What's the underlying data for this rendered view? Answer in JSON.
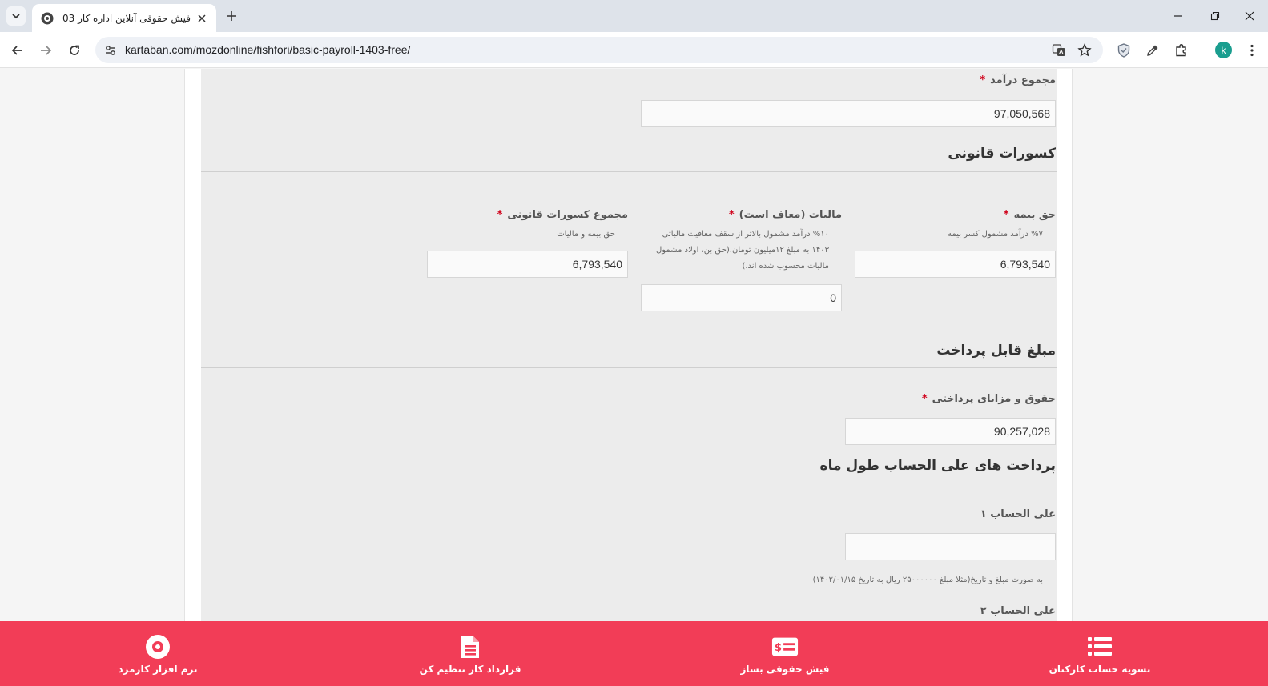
{
  "browser": {
    "tab_title": "فیش حقوقی آنلاین اداره کار 1403",
    "url": "kartaban.com/mozdonline/fishfori/basic-payroll-1403-free/",
    "avatar_letter": "k"
  },
  "form": {
    "total_income": {
      "label": "مجموع درآمد",
      "value": "97,050,568"
    },
    "legal_deductions": {
      "title": "کسورات قانونی",
      "insurance": {
        "label": "حق بیمه",
        "hint": "%۷ درآمد مشمول کسر بیمه",
        "value": "6,793,540"
      },
      "tax": {
        "label": "مالیات (معاف است)",
        "hint_1": "%۱۰ درآمد مشمول بالاتر از سقف معافیت مالیاتی",
        "hint_2": "۱۴۰۳ به مبلغ ۱۲میلیون تومان.(حق بن، اولاد مشمول",
        "hint_3": "مالیات محسوب شده اند.)",
        "value": "0"
      },
      "total": {
        "label": "مجموع کسورات قانونی",
        "hint": "حق بیمه و مالیات",
        "value": "6,793,540"
      }
    },
    "payable": {
      "title": "مبلغ قابل پرداخت",
      "salary": {
        "label": "حقوق و مزایای پرداختی",
        "value": "90,257,028"
      }
    },
    "advances": {
      "title": "پرداخت های علی الحساب طول ماه",
      "advance_1": {
        "label": "علی الحساب ۱",
        "value": "",
        "hint": "به صورت مبلغ و تاریخ(مثلا مبلغ ۲۵۰۰۰۰۰۰ ریال به تاریخ ۱۴۰۲/۰۱/۱۵)"
      },
      "advance_2": {
        "label": "علی الحساب ۲"
      }
    },
    "required_mark": "*"
  },
  "bottom_bar": {
    "item_1": "تسویه حساب کارکنان",
    "item_2": "فیش حقوقی بساز",
    "item_3": "قرارداد کار تنظیم کن",
    "item_4": "نرم افزار کارمزد",
    "payslip_symbol": "$"
  },
  "colors": {
    "accent": "#f23d57",
    "required": "#d0021b"
  }
}
